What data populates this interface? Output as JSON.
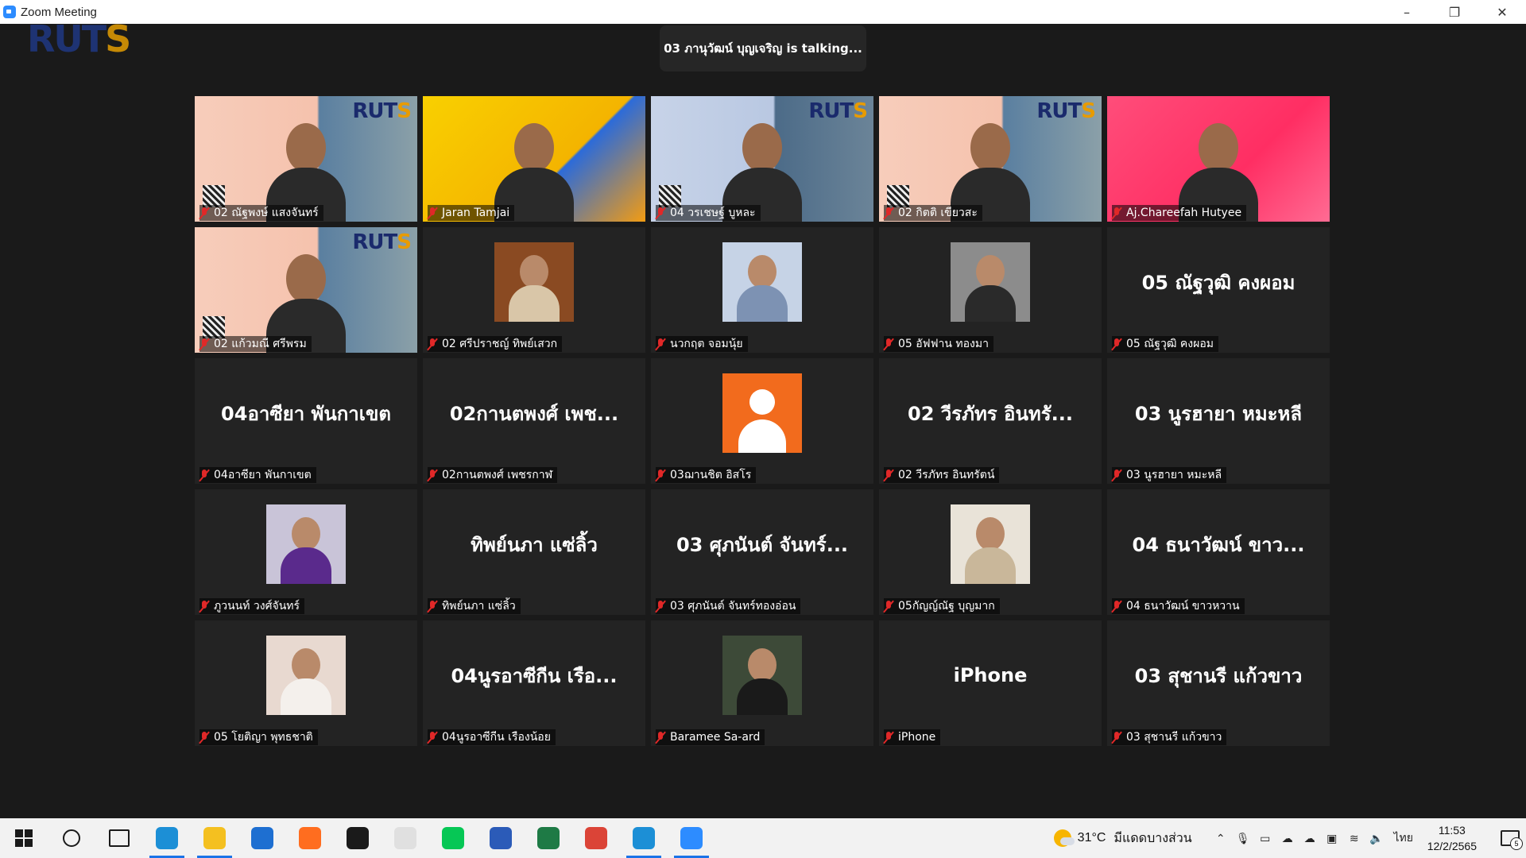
{
  "window": {
    "title": "Zoom Meeting",
    "minimize": "–",
    "restore": "❐",
    "close": "✕"
  },
  "logo": {
    "text_a": "RUT",
    "text_b": "S"
  },
  "talking": "03 ภานุวัฒน์ บุญเจริญ is  talking...",
  "tiles": [
    {
      "label": "02 ณัฐพงษ์ แสงจันทร์",
      "kind": "video",
      "bg": "peach"
    },
    {
      "label": "Jaran Tamjai",
      "kind": "video",
      "bg": "yellow"
    },
    {
      "label": "04 วรเชษฐ์ บูหละ",
      "kind": "video",
      "bg": "blue"
    },
    {
      "label": "02 กิตติ เขียวสะ",
      "kind": "video",
      "bg": "peach"
    },
    {
      "label": "Aj.Chareefah Hutyee",
      "kind": "video",
      "bg": "pink"
    },
    {
      "label": "02 แก้วมณี ศรีพรม",
      "kind": "video",
      "bg": "peach"
    },
    {
      "label": "02 ศรีปราชญ์ ทิพย์เสวก",
      "kind": "photo",
      "photo_bg": "#8a4a22",
      "photo_fg": "#d9c6a8"
    },
    {
      "label": "นวกฤต จอมนุ้ย",
      "kind": "photo",
      "photo_bg": "#c6d3e6",
      "photo_fg": "#7d92b3"
    },
    {
      "label": "05 อัฟฟาน ทองมา",
      "kind": "photo",
      "photo_bg": "#8c8c8c",
      "photo_fg": "#2a2a2a"
    },
    {
      "label": "05 ณัฐวุฒิ คงผอม",
      "kind": "name",
      "bigname": "05 ณัฐวุฒิ คงผอม"
    },
    {
      "label": "04อาซียา พันกาเขต",
      "kind": "name",
      "bigname": "04อาซียา พันกาเขต"
    },
    {
      "label": "02กานตพงศ์ เพชรกาฬ",
      "kind": "name",
      "bigname": "02กานตพงศ์ เพช..."
    },
    {
      "label": "03ฌานชิต อิสโร",
      "kind": "default"
    },
    {
      "label": "02 วีรภัทร อินทรัตน์",
      "kind": "name",
      "bigname": "02 วีรภัทร อินทรั..."
    },
    {
      "label": "03 นูรฮายา หมะหลี",
      "kind": "name",
      "bigname": "03 นูรฮายา หมะหลี"
    },
    {
      "label": "ภูวนนท์ วงศ์จันทร์",
      "kind": "photo",
      "photo_bg": "#c9c4d8",
      "photo_fg": "#5a2a8c"
    },
    {
      "label": "ทิพย์นภา แซ่ลิ้ว",
      "kind": "name",
      "bigname": "ทิพย์นภา แซ่ลิ้ว"
    },
    {
      "label": "03 ศุภนันต์ จันทร์ทองอ่อน",
      "kind": "name",
      "bigname": "03 ศุภนันต์ จันทร์..."
    },
    {
      "label": "05กัญญ์ณัฐ บุญมาก",
      "kind": "photo",
      "photo_bg": "#e9e3d8",
      "photo_fg": "#c9b79a"
    },
    {
      "label": "04 ธนาวัฒน์ ขาวหวาน",
      "kind": "name",
      "bigname": "04 ธนาวัฒน์ ขาว..."
    },
    {
      "label": "05 โยติญา พุทธชาติ",
      "kind": "photo",
      "photo_bg": "#e8d9d0",
      "photo_fg": "#f4f0ec"
    },
    {
      "label": "04นูรอาซีกีน เรืองน้อย",
      "kind": "name",
      "bigname": "04นูรอาซีกีน เรือ..."
    },
    {
      "label": "Baramee Sa-ard",
      "kind": "photo",
      "photo_bg": "#3d4a38",
      "photo_fg": "#1a1a1a"
    },
    {
      "label": "iPhone",
      "kind": "name",
      "bigname": "iPhone"
    },
    {
      "label": "03 สุชานรี แก้วขาว",
      "kind": "name",
      "bigname": "03 สุชานรี แก้วขาว"
    }
  ],
  "taskbar": {
    "apps": [
      {
        "name": "edge-icon",
        "color": "#1c8fd6",
        "active": true
      },
      {
        "name": "file-explorer-icon",
        "color": "#f4c020",
        "active": true
      },
      {
        "name": "mail-icon",
        "color": "#1e6fd1",
        "active": false
      },
      {
        "name": "firefox-icon",
        "color": "#ff6d1f",
        "active": false
      },
      {
        "name": "dropbox-icon",
        "color": "#1a1a1a",
        "active": false
      },
      {
        "name": "amazon-icon",
        "color": "#e0e0e0",
        "active": false
      },
      {
        "name": "line-icon",
        "color": "#06c755",
        "active": false
      },
      {
        "name": "word-icon",
        "color": "#2b5bb8",
        "active": false
      },
      {
        "name": "excel-icon",
        "color": "#1e7a45",
        "active": false
      },
      {
        "name": "chrome-icon",
        "color": "#db4437",
        "active": false
      },
      {
        "name": "edge-icon-2",
        "color": "#1c8fd6",
        "active": true
      },
      {
        "name": "zoom-icon",
        "color": "#2d8cff",
        "active": true
      }
    ],
    "weather_temp": "31°C",
    "weather_desc": "มีแดดบางส่วน",
    "lang": "ไทย",
    "time": "11:53",
    "date": "12/2/2565",
    "notif_count": "5"
  }
}
